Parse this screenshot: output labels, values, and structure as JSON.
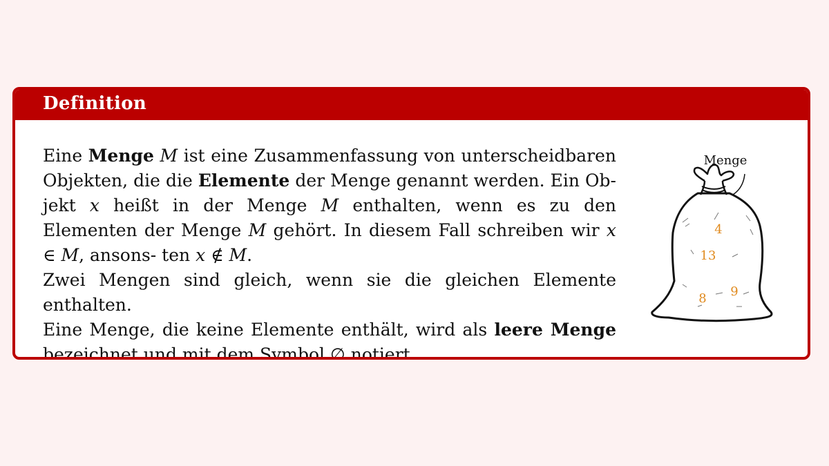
{
  "definition": {
    "title": "Definition",
    "para1": {
      "t1": "Eine ",
      "term_menge": "Menge",
      "t2": " ",
      "var_M1": "M",
      "t3": " ist eine Zusammenfassung von unterscheidbaren Objekten, die die ",
      "term_elemente": "Elemente",
      "t4": " der Menge genannt werden. Ein Ob- jekt ",
      "var_x1": "x",
      "t5": " heißt in der Menge ",
      "var_M2": "M",
      "t6": " enthalten, wenn es zu den Elementen der Menge ",
      "var_M3": "M",
      "t7": " gehört. In diesem Fall schreiben wir ",
      "expr_in": "x ∈ M",
      "t8": ", ansons- ten ",
      "expr_notin": "x ∉ M",
      "t9": "."
    },
    "para2": "Zwei Mengen sind gleich, wenn sie die gleichen Elemente enthalten.",
    "para3": {
      "t1": "Eine Menge, die keine Elemente enthält, wird als ",
      "term_leere": "leere Menge",
      "t2": " bezeichnet und mit dem Symbol ∅ notiert."
    }
  },
  "illustration": {
    "label": "Menge",
    "elements": [
      "4",
      "13",
      "8",
      "9"
    ],
    "element_color": "#e08a1e"
  },
  "colors": {
    "accent": "#bb0000",
    "background": "#fdf2f2"
  }
}
